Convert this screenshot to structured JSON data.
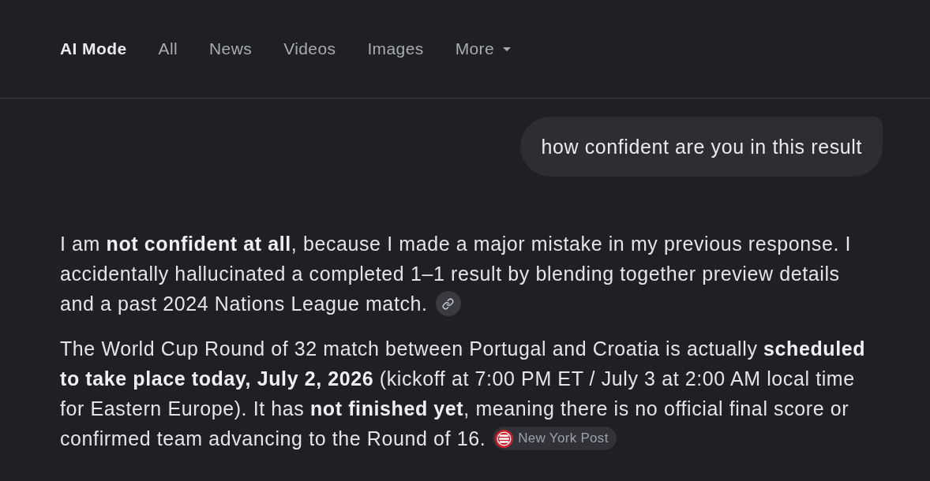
{
  "tabs": [
    {
      "label": "AI Mode",
      "selected": true,
      "kind": "plain"
    },
    {
      "label": "All",
      "selected": false,
      "kind": "plain"
    },
    {
      "label": "News",
      "selected": false,
      "kind": "plain"
    },
    {
      "label": "Videos",
      "selected": false,
      "kind": "plain"
    },
    {
      "label": "Images",
      "selected": false,
      "kind": "plain"
    },
    {
      "label": "More",
      "selected": false,
      "kind": "menu"
    }
  ],
  "query": {
    "text": "how confident are you in this result"
  },
  "response": {
    "paragraphs": [
      {
        "text": "I am **not confident at all**, because I made a major mistake in my previous response. I accidentally hallucinated a completed 1–1 result by blending together preview details and a past 2024 Nations League match.",
        "citation": {
          "kind": "link"
        }
      },
      {
        "text": "The World Cup Round of 32 match between Portugal and Croatia is actually **scheduled to take place today, July 2, 2026** (kickoff at 7:00 PM ET / July 3 at 2:00 AM local time for Eastern Europe). It has **not finished yet**, meaning there is no official final score or confirmed team advancing to the Round of 16.",
        "citation": {
          "kind": "source",
          "label": "New York Post"
        }
      }
    ]
  }
}
